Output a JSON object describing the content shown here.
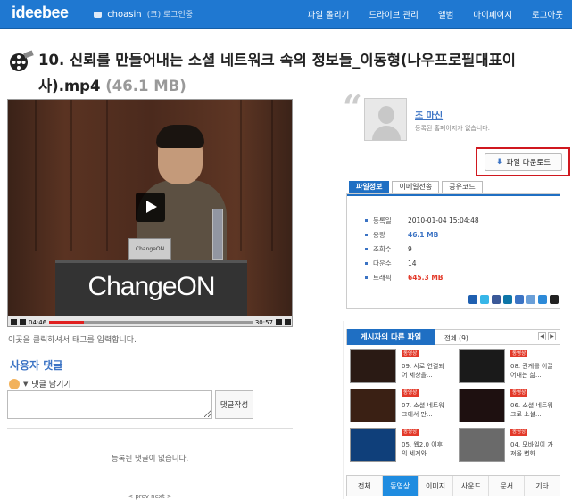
{
  "header": {
    "logo": "ideebee",
    "user": "choasin",
    "login_note": "(크) 로그인중",
    "nav": [
      "파일 올리기",
      "드라이브 관리",
      "앨범",
      "마이페이지",
      "로그아웃"
    ]
  },
  "file": {
    "title": "10. 신뢰를 만들어내는 소셜 네트워크 속의 정보들_이동형(나우프로필대표이사).mp4",
    "size": "(46.1 MB)"
  },
  "video": {
    "podium_text": "ChangeON",
    "laptop_label": "ChangeON",
    "time_current": "04:46",
    "time_total": "30:57",
    "progress": 0.17
  },
  "tag_hint": "이곳을 클릭하셔서 태그를 입력합니다.",
  "comments": {
    "title": "사용자 댓글",
    "author": "댓글 남기기",
    "submit": "댓글작성",
    "empty": "등록된 댓글이 없습니다.",
    "pager": "< prev  next >"
  },
  "profile": {
    "name": "조 마신",
    "desc": "등록된 홈페이지가 없습니다."
  },
  "download_label": "파일 다운로드",
  "tabs": [
    "파일정보",
    "이메일전송",
    "공유코드"
  ],
  "file_info": [
    {
      "k": "등록일",
      "v": "2010-01-04 15:04:48",
      "style": ""
    },
    {
      "k": "용량",
      "v": "46.1 MB",
      "style": "blue"
    },
    {
      "k": "조회수",
      "v": "9",
      "style": ""
    },
    {
      "k": "다운수",
      "v": "14",
      "style": ""
    },
    {
      "k": "트래픽",
      "v": "645.3 MB",
      "style": "red"
    }
  ],
  "other_files": {
    "title": "게시자의 다른 파일",
    "all": "전체 (9)",
    "items": [
      {
        "badge": "동영상",
        "title": "09. 서로 연결되어 세상을..."
      },
      {
        "badge": "동영상",
        "title": "08. 관계를 이끌어내는 삶..."
      },
      {
        "badge": "동영상",
        "title": "07. 소셜 네트워크에서 만..."
      },
      {
        "badge": "동영상",
        "title": "06. 소셜 네트워크로 소셜..."
      },
      {
        "badge": "동영상",
        "title": "05. 웹2.0 이후의 세계와..."
      },
      {
        "badge": "동영상",
        "title": "04. 모바일이 가져올 변화..."
      }
    ]
  },
  "categories": [
    "전체",
    "동영상",
    "이미지",
    "사운드",
    "문서",
    "기타"
  ],
  "active_category": "동영상"
}
